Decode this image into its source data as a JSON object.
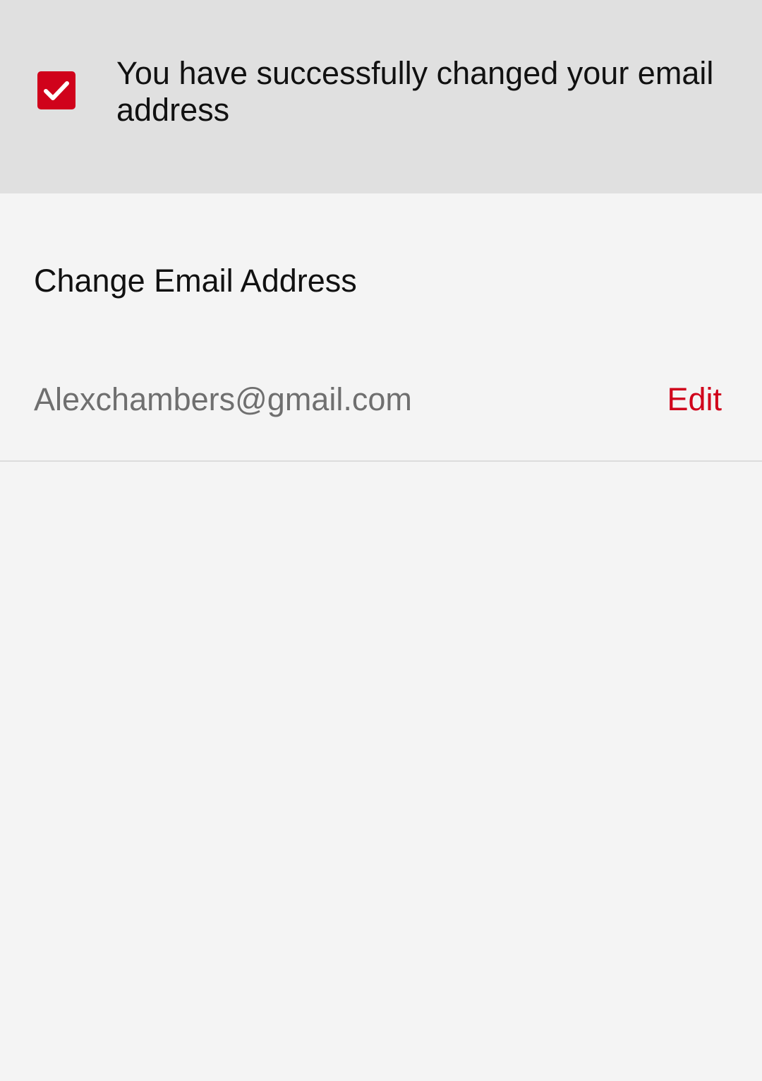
{
  "colors": {
    "accent": "#d0021b",
    "banner_background": "#e0e0e0",
    "page_background": "#f4f4f4",
    "primary_text": "#111111",
    "secondary_text": "#6f6f6f"
  },
  "banner": {
    "icon": "checkbox-checked-icon",
    "message": "You have successfully changed your email address"
  },
  "section": {
    "title": "Change Email Address"
  },
  "email_row": {
    "value": "Alexchambers@gmail.com",
    "edit_label": "Edit"
  }
}
